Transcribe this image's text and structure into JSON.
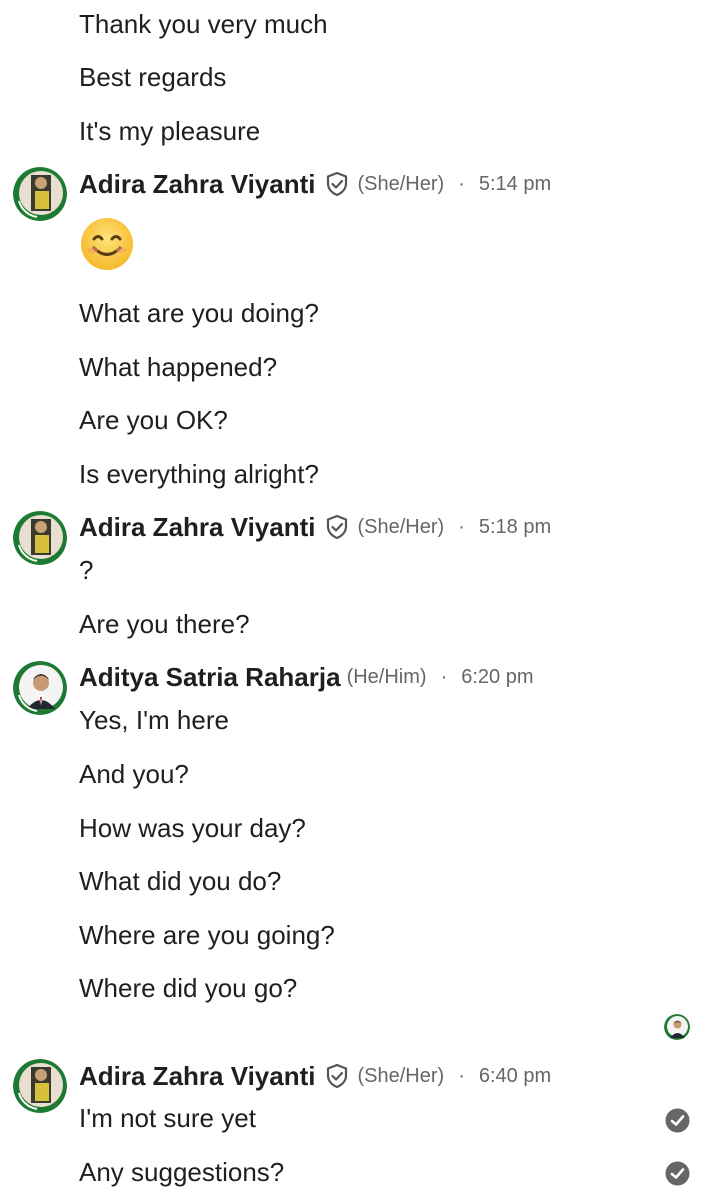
{
  "messages_top": {
    "line1": "Thank you very much",
    "line2": "Best regards",
    "line3": "It's my pleasure"
  },
  "group1": {
    "sender": "Adira Zahra Viyanti",
    "pronouns": "(She/Her)",
    "dot": "·",
    "time": "5:14 pm",
    "emoji": "smiling-face-emoji",
    "lines": [
      "What are you doing?",
      "What happened?",
      "Are you OK?",
      "Is everything alright?"
    ]
  },
  "group2": {
    "sender": "Adira Zahra Viyanti",
    "pronouns": "(She/Her)",
    "dot": "·",
    "time": "5:18 pm",
    "lines": [
      "?",
      "Are you there?"
    ]
  },
  "group3": {
    "sender": "Aditya Satria Raharja",
    "pronouns": "(He/Him)",
    "dot": "·",
    "time": "6:20 pm",
    "lines": [
      "Yes, I'm here",
      "And you?",
      "How was your day?",
      "What did you do?",
      "Where are you going?",
      "Where did you go?"
    ]
  },
  "group4": {
    "sender": "Adira Zahra Viyanti",
    "pronouns": "(She/Her)",
    "dot": "·",
    "time": "6:40 pm",
    "lines": [
      "I'm not sure yet",
      "Any suggestions?"
    ]
  },
  "icons": {
    "verified": "shield-check-icon",
    "read_receipt": "check-circle-icon",
    "seen_avatar": "seen-by-avatar"
  },
  "colors": {
    "text": "#1f1f1f",
    "meta": "#666666",
    "avatar_ring": "#1e7a32",
    "check": "#666666"
  }
}
